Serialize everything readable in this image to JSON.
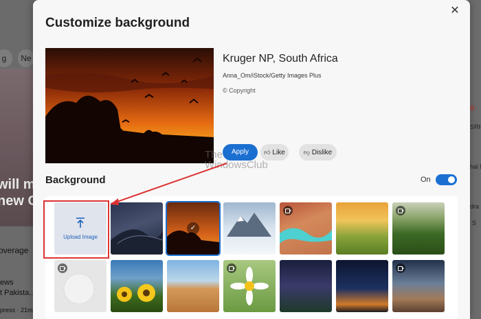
{
  "background_page": {
    "tab_left": "g",
    "tab_2": "Ne",
    "headline_line1": "will ma",
    "headline_line2": "new C",
    "coverage": "overage",
    "news": "ews",
    "pakistan": "t Pakista..",
    "press": "press · 21m",
    "right_0": "0",
    "right_srh": "SRH",
    "right_hal": "hal P",
    "right_dra": "dra N",
    "right_s": "S"
  },
  "dialog": {
    "title": "Customize background",
    "close_label": "✕",
    "image": {
      "title": "Kruger NP, South Africa",
      "credit": "Anna_Om/iStock/Getty Images Plus",
      "copyright": "© Copyright"
    },
    "buttons": {
      "apply": "Apply",
      "like": "Like",
      "dislike": "Dislike"
    },
    "watermark_line1": "The",
    "watermark_line2": "WindowsClub",
    "background_section": {
      "title": "Background",
      "toggle_label": "On",
      "toggle_on": true
    },
    "upload_label": "Upload Image",
    "tiles": [
      {
        "name": "desert-dunes-blue",
        "video": false,
        "selected": false
      },
      {
        "name": "kruger-sunset",
        "video": false,
        "selected": true
      },
      {
        "name": "snowy-mountains",
        "video": false,
        "selected": false
      },
      {
        "name": "turquoise-river",
        "video": true,
        "selected": false
      },
      {
        "name": "golden-fields",
        "video": false,
        "selected": false
      },
      {
        "name": "green-valley",
        "video": true,
        "selected": false
      },
      {
        "name": "white-sphere",
        "video": true,
        "selected": false
      },
      {
        "name": "sunflowers",
        "video": false,
        "selected": false
      },
      {
        "name": "sand-dune",
        "video": false,
        "selected": false
      },
      {
        "name": "daisy-flower",
        "video": true,
        "selected": false
      },
      {
        "name": "milky-way",
        "video": false,
        "selected": false
      },
      {
        "name": "night-horizon",
        "video": false,
        "selected": false
      },
      {
        "name": "desert-night",
        "video": true,
        "selected": false
      }
    ]
  },
  "colors": {
    "accent": "#1b6fd1",
    "annotation": "#dd3333"
  }
}
